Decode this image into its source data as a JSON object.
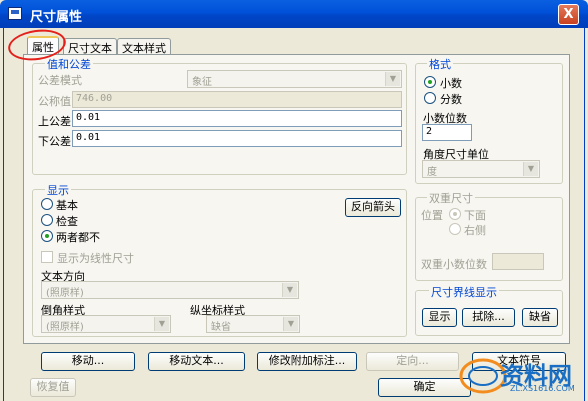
{
  "window": {
    "title": "尺寸属性",
    "close_label": "X"
  },
  "tabs": [
    {
      "label": "属性",
      "active": true
    },
    {
      "label": "尺寸文本",
      "active": false
    },
    {
      "label": "文本样式",
      "active": false
    }
  ],
  "values_tolerances": {
    "group_label": "值和公差",
    "tolerance_mode_label": "公差模式",
    "tolerance_mode_value": "象征",
    "nominal_label": "公称值",
    "nominal_value": "746.00",
    "upper_label": "上公差",
    "upper_value": "0.01",
    "lower_label": "下公差",
    "lower_value": "0.01"
  },
  "format": {
    "group_label": "格式",
    "decimal_label": "小数",
    "fraction_label": "分数",
    "selected": "decimal",
    "decimal_places_label": "小数位数",
    "decimal_places_value": "2",
    "angle_unit_label": "角度尺寸单位",
    "angle_unit_value": "度"
  },
  "display": {
    "group_label": "显示",
    "basic_label": "基本",
    "inspection_label": "检查",
    "neither_label": "两者都不",
    "selected": "neither",
    "flip_arrows_label": "反向箭头",
    "linear_checkbox_label": "显示为线性尺寸",
    "text_direction_label": "文本方向",
    "text_direction_value": "(照原样)",
    "chamfer_style_label": "倒角样式",
    "chamfer_style_value": "(照原样)",
    "ordinate_style_label": "纵坐标样式",
    "ordinate_style_value": "缺省"
  },
  "dual": {
    "group_label": "双重尺寸",
    "position_label": "位置",
    "below_label": "下面",
    "right_label": "右侧",
    "dual_decimals_label": "双重小数位数"
  },
  "witness": {
    "group_label": "尺寸界线显示",
    "show_label": "显示",
    "erase_label": "拭除...",
    "default_label": "缺省"
  },
  "bottom": {
    "move_label": "移动...",
    "move_text_label": "移动文本...",
    "modify_attach_label": "修改附加标注...",
    "orient_label": "定向...",
    "text_symbol_label": "文本符号",
    "restore_label": "恢复值",
    "ok_label": "确定"
  },
  "watermark": {
    "text": "资料网",
    "url": "ZL.XS1616.COM"
  },
  "colors": {
    "title_bar": "#0054e3",
    "dialog_bg": "#ece9d8",
    "group_label": "#0046d5",
    "highlight": "#e3201b",
    "watermark": "#1a6fc4"
  }
}
